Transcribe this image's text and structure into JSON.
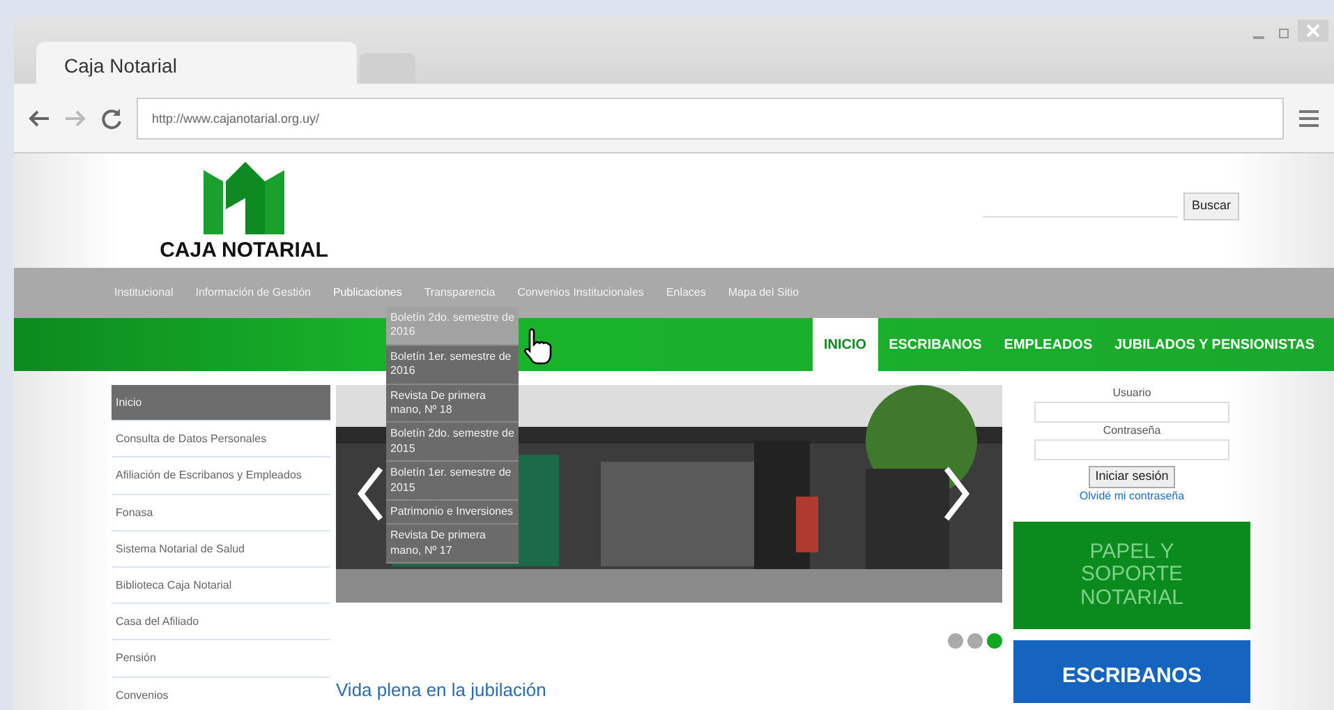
{
  "browser": {
    "tab_title": "Caja Notarial",
    "url": "http://www.cajanotarial.org.uy/"
  },
  "header": {
    "logo_text": "CAJA NOTARIAL",
    "search_button": "Buscar"
  },
  "top_menu": [
    {
      "label": "Institucional",
      "selected": false
    },
    {
      "label": "Información de Gestión",
      "selected": false
    },
    {
      "label": "Publicaciones",
      "selected": true
    },
    {
      "label": "Transparencia",
      "selected": false
    },
    {
      "label": "Convenios Institucionales",
      "selected": false
    },
    {
      "label": "Enlaces",
      "selected": false
    },
    {
      "label": "Mapa del Sitio",
      "selected": false
    }
  ],
  "dropdown": [
    {
      "label": "Boletín 2do. semestre de 2016",
      "selected": true
    },
    {
      "label": "Boletín 1er. semestre de 2016",
      "selected": false
    },
    {
      "label": "Revista De primera mano, Nº 18",
      "selected": false
    },
    {
      "label": "Boletín 2do. semestre de 2015",
      "selected": false
    },
    {
      "label": "Boletín 1er. semestre de 2015",
      "selected": false
    },
    {
      "label": "Patrimonio e Inversiones",
      "selected": false
    },
    {
      "label": "Revista De primera mano, Nº 17",
      "selected": false
    }
  ],
  "audience_tabs": [
    {
      "label": "INICIO",
      "selected": true
    },
    {
      "label": "ESCRIBANOS",
      "selected": false
    },
    {
      "label": "EMPLEADOS",
      "selected": false
    },
    {
      "label": "JUBILADOS Y PENSIONISTAS",
      "selected": false
    }
  ],
  "sidebar": [
    {
      "label": "Inicio",
      "selected": true
    },
    {
      "label": "Consulta de Datos Personales",
      "selected": false
    },
    {
      "label": "Afiliación de Escribanos y Empleados",
      "selected": false
    },
    {
      "label": "Fonasa",
      "selected": false
    },
    {
      "label": "Sistema Notarial de Salud",
      "selected": false
    },
    {
      "label": "Biblioteca Caja Notarial",
      "selected": false
    },
    {
      "label": "Casa del Afiliado",
      "selected": false
    },
    {
      "label": "Pensión",
      "selected": false
    },
    {
      "label": "Convenios",
      "selected": false
    }
  ],
  "slider": {
    "dots": [
      {
        "selected": false
      },
      {
        "selected": false
      },
      {
        "selected": true
      }
    ]
  },
  "news_title": "Vida plena en la jubilación",
  "login": {
    "user_label": "Usuario",
    "password_label": "Contraseña",
    "submit": "Iniciar sesión",
    "forgot_link": "Olvidé mi contraseña"
  },
  "promos": [
    {
      "label": "PAPEL Y SOPORTE NOTARIAL",
      "color": "#0b8a1e"
    },
    {
      "label": "ESCRIBANOS",
      "color": "#1565c0"
    }
  ]
}
